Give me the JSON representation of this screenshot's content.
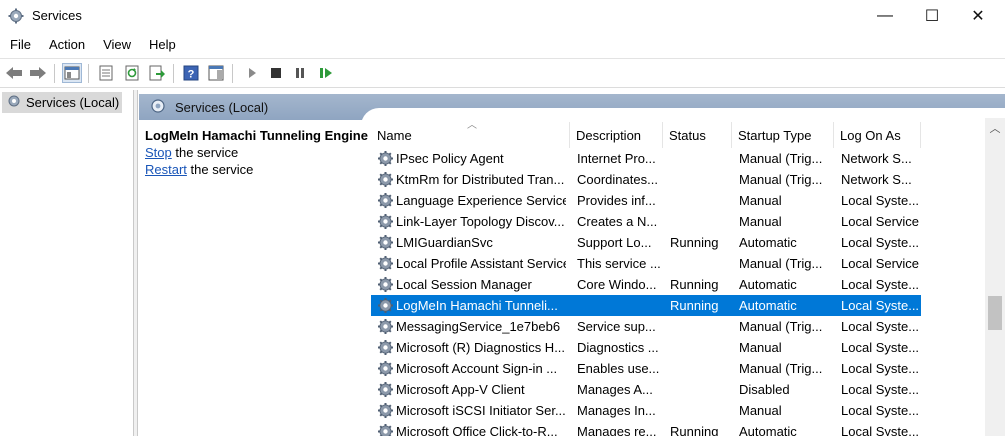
{
  "window": {
    "title": "Services",
    "controls": {
      "minimize": "—",
      "maximize": "☐",
      "close": "✕"
    }
  },
  "menu": [
    "File",
    "Action",
    "View",
    "Help"
  ],
  "toolbar": {
    "icons": [
      "back-arrow-icon",
      "forward-arrow-icon",
      "show-console-tree-icon",
      "properties-icon",
      "refresh-icon",
      "export-list-icon",
      "help-icon",
      "action-pane-icon",
      "start-service-icon",
      "stop-service-icon",
      "pause-service-icon",
      "resume-service-icon"
    ]
  },
  "tree": {
    "root_label": "Services (Local)"
  },
  "pane": {
    "header": "Services (Local)",
    "selected_service": "LogMeIn Hamachi Tunneling Engine",
    "action_stop_link": "Stop",
    "action_stop_rest": " the service",
    "action_restart_link": "Restart",
    "action_restart_rest": " the service"
  },
  "columns": {
    "name": "Name",
    "description": "Description",
    "status": "Status",
    "startup": "Startup Type",
    "logon": "Log On As"
  },
  "services": [
    {
      "name": "IPsec Policy Agent",
      "description": "Internet Pro...",
      "status": "",
      "startup": "Manual (Trig...",
      "logon": "Network S..."
    },
    {
      "name": "KtmRm for Distributed Tran...",
      "description": "Coordinates...",
      "status": "",
      "startup": "Manual (Trig...",
      "logon": "Network S..."
    },
    {
      "name": "Language Experience Service",
      "description": "Provides inf...",
      "status": "",
      "startup": "Manual",
      "logon": "Local Syste..."
    },
    {
      "name": "Link-Layer Topology Discov...",
      "description": "Creates a N...",
      "status": "",
      "startup": "Manual",
      "logon": "Local Service"
    },
    {
      "name": "LMIGuardianSvc",
      "description": "Support Lo...",
      "status": "Running",
      "startup": "Automatic",
      "logon": "Local Syste..."
    },
    {
      "name": "Local Profile Assistant Service",
      "description": "This service ...",
      "status": "",
      "startup": "Manual (Trig...",
      "logon": "Local Service"
    },
    {
      "name": "Local Session Manager",
      "description": "Core Windo...",
      "status": "Running",
      "startup": "Automatic",
      "logon": "Local Syste..."
    },
    {
      "name": "LogMeIn Hamachi Tunneli...",
      "description": "",
      "status": "Running",
      "startup": "Automatic",
      "logon": "Local Syste...",
      "selected": true
    },
    {
      "name": "MessagingService_1e7beb6",
      "description": "Service sup...",
      "status": "",
      "startup": "Manual (Trig...",
      "logon": "Local Syste..."
    },
    {
      "name": "Microsoft (R) Diagnostics H...",
      "description": "Diagnostics ...",
      "status": "",
      "startup": "Manual",
      "logon": "Local Syste..."
    },
    {
      "name": "Microsoft Account Sign-in ...",
      "description": "Enables use...",
      "status": "",
      "startup": "Manual (Trig...",
      "logon": "Local Syste..."
    },
    {
      "name": "Microsoft App-V Client",
      "description": "Manages A...",
      "status": "",
      "startup": "Disabled",
      "logon": "Local Syste..."
    },
    {
      "name": "Microsoft iSCSI Initiator Ser...",
      "description": "Manages In...",
      "status": "",
      "startup": "Manual",
      "logon": "Local Syste..."
    },
    {
      "name": "Microsoft Office Click-to-R...",
      "description": "Manages re...",
      "status": "Running",
      "startup": "Automatic",
      "logon": "Local Syste..."
    }
  ],
  "colors": {
    "selection": "#0078d7",
    "header_band": "#99adc7",
    "link": "#1a56b8"
  }
}
